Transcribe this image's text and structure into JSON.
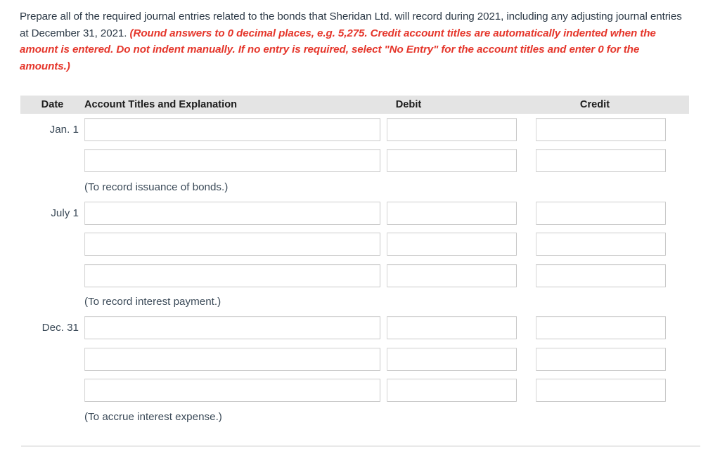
{
  "instructions": {
    "plain_part_1": "Prepare all of the required journal entries related to the bonds that Sheridan Ltd. will record during 2021, including any adjusting journal entries at December 31, 2021. ",
    "emphasis_part": "(Round answers to 0 decimal places, e.g. 5,275. Credit account titles are automatically indented when the amount is entered. Do not indent manually. If no entry is required, select \"No Entry\" for the account titles and enter 0 for the amounts.)",
    "emphasis_color": "#e5362b",
    "text_color": "#2d3a47"
  },
  "table": {
    "header_background": "#e4e4e4",
    "headers": {
      "date": "Date",
      "account": "Account Titles and Explanation",
      "debit": "Debit",
      "credit": "Credit"
    },
    "input_placeholder": "",
    "input_value": "",
    "entries": [
      {
        "date": "Jan. 1",
        "line_count": 2,
        "memo": "(To record issuance of bonds.)"
      },
      {
        "date": "July 1",
        "line_count": 3,
        "memo": "(To record interest payment.)"
      },
      {
        "date": "Dec. 31",
        "line_count": 3,
        "memo": "(To accrue interest expense.)"
      }
    ]
  }
}
